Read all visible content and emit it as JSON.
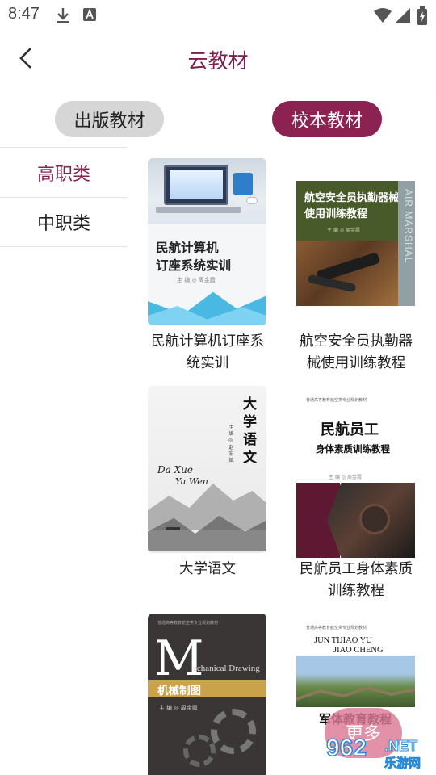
{
  "status_bar": {
    "time": "8:47",
    "icons": [
      "download-icon",
      "font-a-icon",
      "wifi-icon",
      "signal-icon",
      "battery-charging-icon"
    ]
  },
  "header": {
    "title": "云教材",
    "back_icon": "chevron-left-icon"
  },
  "tabs": [
    {
      "label": "出版教材",
      "active": false
    },
    {
      "label": "校本教材",
      "active": true
    }
  ],
  "categories": [
    {
      "label": "高职类",
      "active": true
    },
    {
      "label": "中职类",
      "active": false
    }
  ],
  "books": [
    {
      "title": "民航计算机订座系统实训",
      "title_lines": [
        "民航计算机订座系",
        "统实训"
      ],
      "cover": {
        "title_lines": [
          "民航计算机",
          "订座系统实训"
        ],
        "author": "主 编 ◎ 周金霞"
      }
    },
    {
      "title": "航空安全员执勤器械使用训练教程",
      "title_lines": [
        "航空安全员执勤器",
        "械使用训练教程"
      ],
      "cover": {
        "title_lines": [
          "航空安全员执勤器械",
          "使用训练教程"
        ],
        "author": "主 编 ◎ 周金霞",
        "side_text": "AIR MARSHAL"
      }
    },
    {
      "title": "大学语文",
      "title_lines": [
        "大学语文"
      ],
      "cover": {
        "title_lines": [
          "大",
          "学",
          "语",
          "文"
        ],
        "pinyin_1": "Da Xue",
        "pinyin_2": "Yu Wen",
        "author": "主 编 ◎ 赵 宏 斌"
      }
    },
    {
      "title": "民航员工身体素质训练教程",
      "title_lines": [
        "民航员工身体素质",
        "训练教程"
      ],
      "cover": {
        "header": "普通高等教育航空类专业规划教材",
        "title_1": "民航员工",
        "title_2": "身体素质训练教程",
        "author": "主 编 ◎ 周金霞"
      }
    },
    {
      "title": "机械制图",
      "title_lines": [],
      "cover": {
        "header": "普通高等教育航空类专业规划教材",
        "big_letter": "M",
        "english": "echanical Drawing",
        "title": "机械制图",
        "author": "主 编 ◎ 周金霞"
      }
    },
    {
      "title": "军体教育教程",
      "title_lines": [],
      "cover": {
        "header": "普通高等教育航空类专业规划教材",
        "english_1": "JUN TIJIAO YU",
        "english_2": "JIAO CHENG",
        "title": "军体教育教程"
      }
    }
  ],
  "more_button": {
    "label": "更多"
  },
  "watermark": {
    "number": "962",
    "domain": ".NET",
    "chinese": "乐游网"
  },
  "colors": {
    "accent": "#8b2252",
    "title": "#7a1f4e",
    "tab_inactive_bg": "#d6d6d6"
  }
}
